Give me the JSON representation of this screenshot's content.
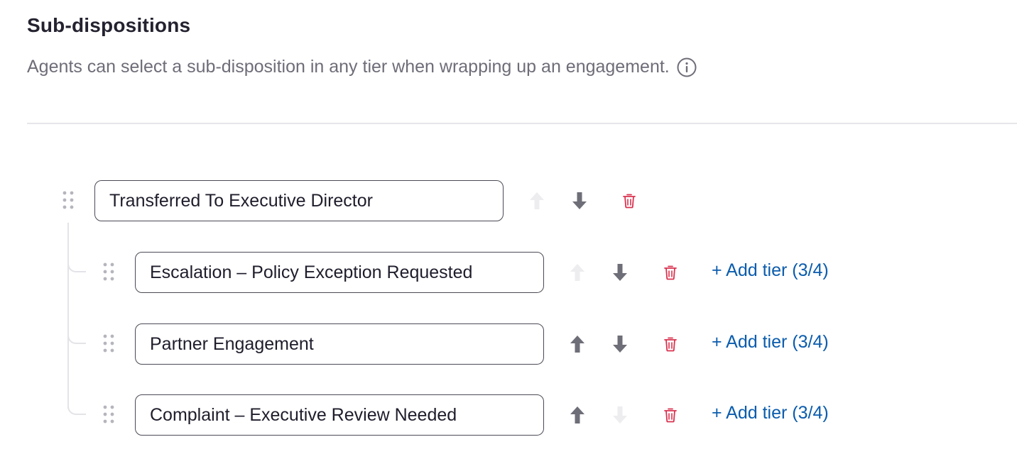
{
  "header": {
    "title": "Sub-dispositions",
    "description": "Agents can select a sub-disposition in any tier when wrapping up an engagement."
  },
  "colors": {
    "arrow_enabled": "#6e6e78",
    "arrow_disabled": "#ededf0",
    "delete": "#d9324e",
    "link": "#0b5cad"
  },
  "tiers": [
    {
      "value": "Transferred To Executive Director",
      "move_up_enabled": false,
      "move_down_enabled": true,
      "add_tier_label": ""
    },
    {
      "value": "Escalation – Policy Exception Requested",
      "move_up_enabled": false,
      "move_down_enabled": true,
      "add_tier_label": "+ Add tier (3/4)"
    },
    {
      "value": "Partner Engagement",
      "move_up_enabled": true,
      "move_down_enabled": true,
      "add_tier_label": "+ Add tier (3/4)"
    },
    {
      "value": "Complaint – Executive Review Needed",
      "move_up_enabled": true,
      "move_down_enabled": false,
      "add_tier_label": "+ Add tier (3/4)"
    }
  ]
}
